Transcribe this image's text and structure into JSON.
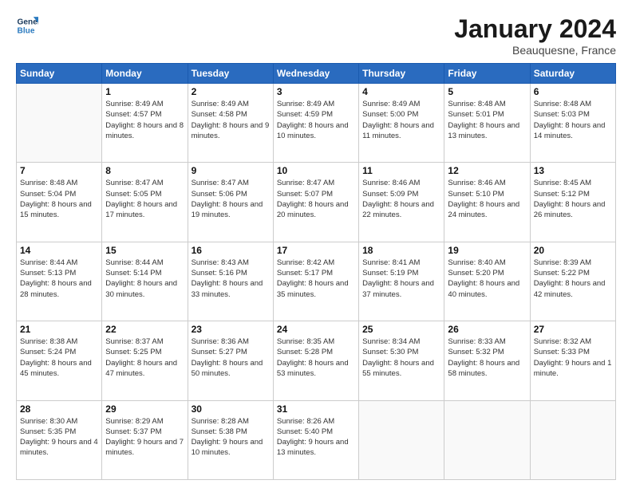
{
  "header": {
    "logo_line1": "General",
    "logo_line2": "Blue",
    "month": "January 2024",
    "location": "Beauquesne, France"
  },
  "days_of_week": [
    "Sunday",
    "Monday",
    "Tuesday",
    "Wednesday",
    "Thursday",
    "Friday",
    "Saturday"
  ],
  "weeks": [
    [
      {
        "day": "",
        "empty": true
      },
      {
        "day": "1",
        "sunrise": "Sunrise: 8:49 AM",
        "sunset": "Sunset: 4:57 PM",
        "daylight": "Daylight: 8 hours and 8 minutes."
      },
      {
        "day": "2",
        "sunrise": "Sunrise: 8:49 AM",
        "sunset": "Sunset: 4:58 PM",
        "daylight": "Daylight: 8 hours and 9 minutes."
      },
      {
        "day": "3",
        "sunrise": "Sunrise: 8:49 AM",
        "sunset": "Sunset: 4:59 PM",
        "daylight": "Daylight: 8 hours and 10 minutes."
      },
      {
        "day": "4",
        "sunrise": "Sunrise: 8:49 AM",
        "sunset": "Sunset: 5:00 PM",
        "daylight": "Daylight: 8 hours and 11 minutes."
      },
      {
        "day": "5",
        "sunrise": "Sunrise: 8:48 AM",
        "sunset": "Sunset: 5:01 PM",
        "daylight": "Daylight: 8 hours and 13 minutes."
      },
      {
        "day": "6",
        "sunrise": "Sunrise: 8:48 AM",
        "sunset": "Sunset: 5:03 PM",
        "daylight": "Daylight: 8 hours and 14 minutes."
      }
    ],
    [
      {
        "day": "7",
        "sunrise": "Sunrise: 8:48 AM",
        "sunset": "Sunset: 5:04 PM",
        "daylight": "Daylight: 8 hours and 15 minutes."
      },
      {
        "day": "8",
        "sunrise": "Sunrise: 8:47 AM",
        "sunset": "Sunset: 5:05 PM",
        "daylight": "Daylight: 8 hours and 17 minutes."
      },
      {
        "day": "9",
        "sunrise": "Sunrise: 8:47 AM",
        "sunset": "Sunset: 5:06 PM",
        "daylight": "Daylight: 8 hours and 19 minutes."
      },
      {
        "day": "10",
        "sunrise": "Sunrise: 8:47 AM",
        "sunset": "Sunset: 5:07 PM",
        "daylight": "Daylight: 8 hours and 20 minutes."
      },
      {
        "day": "11",
        "sunrise": "Sunrise: 8:46 AM",
        "sunset": "Sunset: 5:09 PM",
        "daylight": "Daylight: 8 hours and 22 minutes."
      },
      {
        "day": "12",
        "sunrise": "Sunrise: 8:46 AM",
        "sunset": "Sunset: 5:10 PM",
        "daylight": "Daylight: 8 hours and 24 minutes."
      },
      {
        "day": "13",
        "sunrise": "Sunrise: 8:45 AM",
        "sunset": "Sunset: 5:12 PM",
        "daylight": "Daylight: 8 hours and 26 minutes."
      }
    ],
    [
      {
        "day": "14",
        "sunrise": "Sunrise: 8:44 AM",
        "sunset": "Sunset: 5:13 PM",
        "daylight": "Daylight: 8 hours and 28 minutes."
      },
      {
        "day": "15",
        "sunrise": "Sunrise: 8:44 AM",
        "sunset": "Sunset: 5:14 PM",
        "daylight": "Daylight: 8 hours and 30 minutes."
      },
      {
        "day": "16",
        "sunrise": "Sunrise: 8:43 AM",
        "sunset": "Sunset: 5:16 PM",
        "daylight": "Daylight: 8 hours and 33 minutes."
      },
      {
        "day": "17",
        "sunrise": "Sunrise: 8:42 AM",
        "sunset": "Sunset: 5:17 PM",
        "daylight": "Daylight: 8 hours and 35 minutes."
      },
      {
        "day": "18",
        "sunrise": "Sunrise: 8:41 AM",
        "sunset": "Sunset: 5:19 PM",
        "daylight": "Daylight: 8 hours and 37 minutes."
      },
      {
        "day": "19",
        "sunrise": "Sunrise: 8:40 AM",
        "sunset": "Sunset: 5:20 PM",
        "daylight": "Daylight: 8 hours and 40 minutes."
      },
      {
        "day": "20",
        "sunrise": "Sunrise: 8:39 AM",
        "sunset": "Sunset: 5:22 PM",
        "daylight": "Daylight: 8 hours and 42 minutes."
      }
    ],
    [
      {
        "day": "21",
        "sunrise": "Sunrise: 8:38 AM",
        "sunset": "Sunset: 5:24 PM",
        "daylight": "Daylight: 8 hours and 45 minutes."
      },
      {
        "day": "22",
        "sunrise": "Sunrise: 8:37 AM",
        "sunset": "Sunset: 5:25 PM",
        "daylight": "Daylight: 8 hours and 47 minutes."
      },
      {
        "day": "23",
        "sunrise": "Sunrise: 8:36 AM",
        "sunset": "Sunset: 5:27 PM",
        "daylight": "Daylight: 8 hours and 50 minutes."
      },
      {
        "day": "24",
        "sunrise": "Sunrise: 8:35 AM",
        "sunset": "Sunset: 5:28 PM",
        "daylight": "Daylight: 8 hours and 53 minutes."
      },
      {
        "day": "25",
        "sunrise": "Sunrise: 8:34 AM",
        "sunset": "Sunset: 5:30 PM",
        "daylight": "Daylight: 8 hours and 55 minutes."
      },
      {
        "day": "26",
        "sunrise": "Sunrise: 8:33 AM",
        "sunset": "Sunset: 5:32 PM",
        "daylight": "Daylight: 8 hours and 58 minutes."
      },
      {
        "day": "27",
        "sunrise": "Sunrise: 8:32 AM",
        "sunset": "Sunset: 5:33 PM",
        "daylight": "Daylight: 9 hours and 1 minute."
      }
    ],
    [
      {
        "day": "28",
        "sunrise": "Sunrise: 8:30 AM",
        "sunset": "Sunset: 5:35 PM",
        "daylight": "Daylight: 9 hours and 4 minutes."
      },
      {
        "day": "29",
        "sunrise": "Sunrise: 8:29 AM",
        "sunset": "Sunset: 5:37 PM",
        "daylight": "Daylight: 9 hours and 7 minutes."
      },
      {
        "day": "30",
        "sunrise": "Sunrise: 8:28 AM",
        "sunset": "Sunset: 5:38 PM",
        "daylight": "Daylight: 9 hours and 10 minutes."
      },
      {
        "day": "31",
        "sunrise": "Sunrise: 8:26 AM",
        "sunset": "Sunset: 5:40 PM",
        "daylight": "Daylight: 9 hours and 13 minutes."
      },
      {
        "day": "",
        "empty": true
      },
      {
        "day": "",
        "empty": true
      },
      {
        "day": "",
        "empty": true
      }
    ]
  ]
}
